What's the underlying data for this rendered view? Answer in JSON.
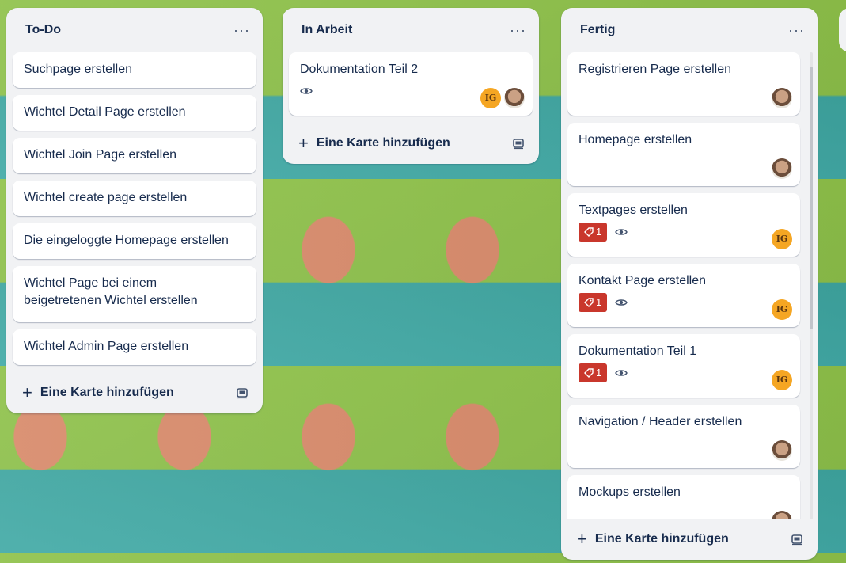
{
  "colors": {
    "list_bg": "#f1f2f4",
    "card_bg": "#ffffff",
    "label_red": "#c9372c",
    "avatar_orange": "#f5a623",
    "text": "#172b4d"
  },
  "lists": [
    {
      "title": "To-Do",
      "menu": "···",
      "add_label": "Eine Karte hinzufügen",
      "cards": [
        {
          "title": "Suchpage erstellen"
        },
        {
          "title": "Wichtel Detail Page erstellen"
        },
        {
          "title": "Wichtel Join Page erstellen"
        },
        {
          "title": "Wichtel create page erstellen"
        },
        {
          "title": "Die eingeloggte Homepage erstellen"
        },
        {
          "title": "Wichtel Page bei einem beigetretenen Wichtel erstellen"
        },
        {
          "title": "Wichtel Admin Page erstellen"
        }
      ]
    },
    {
      "title": "In Arbeit",
      "menu": "···",
      "add_label": "Eine Karte hinzufügen",
      "cards": [
        {
          "title": "Dokumentation Teil 2",
          "watch": true,
          "avatars": [
            "IG",
            "photo"
          ]
        }
      ]
    },
    {
      "title": "Fertig",
      "menu": "···",
      "add_label": "Eine Karte hinzufügen",
      "cards": [
        {
          "title": "Registrieren Page erstellen",
          "avatars": [
            "photo"
          ]
        },
        {
          "title": "Homepage erstellen",
          "avatars": [
            "photo"
          ]
        },
        {
          "title": "Textpages erstellen",
          "label_count": "1",
          "watch": true,
          "avatars": [
            "IG"
          ]
        },
        {
          "title": "Kontakt Page erstellen",
          "label_count": "1",
          "watch": true,
          "avatars": [
            "IG"
          ]
        },
        {
          "title": "Dokumentation Teil 1",
          "label_count": "1",
          "watch": true,
          "avatars": [
            "IG"
          ]
        },
        {
          "title": "Navigation / Header erstellen",
          "avatars": [
            "photo"
          ]
        },
        {
          "title": "Mockups erstellen",
          "avatars": [
            "photo"
          ]
        }
      ]
    }
  ],
  "avatar_initials": "IG",
  "icons": [
    "dots-menu-icon",
    "eye-icon",
    "tag-icon",
    "plus-icon",
    "card-template-icon",
    "user-avatar-photo"
  ]
}
